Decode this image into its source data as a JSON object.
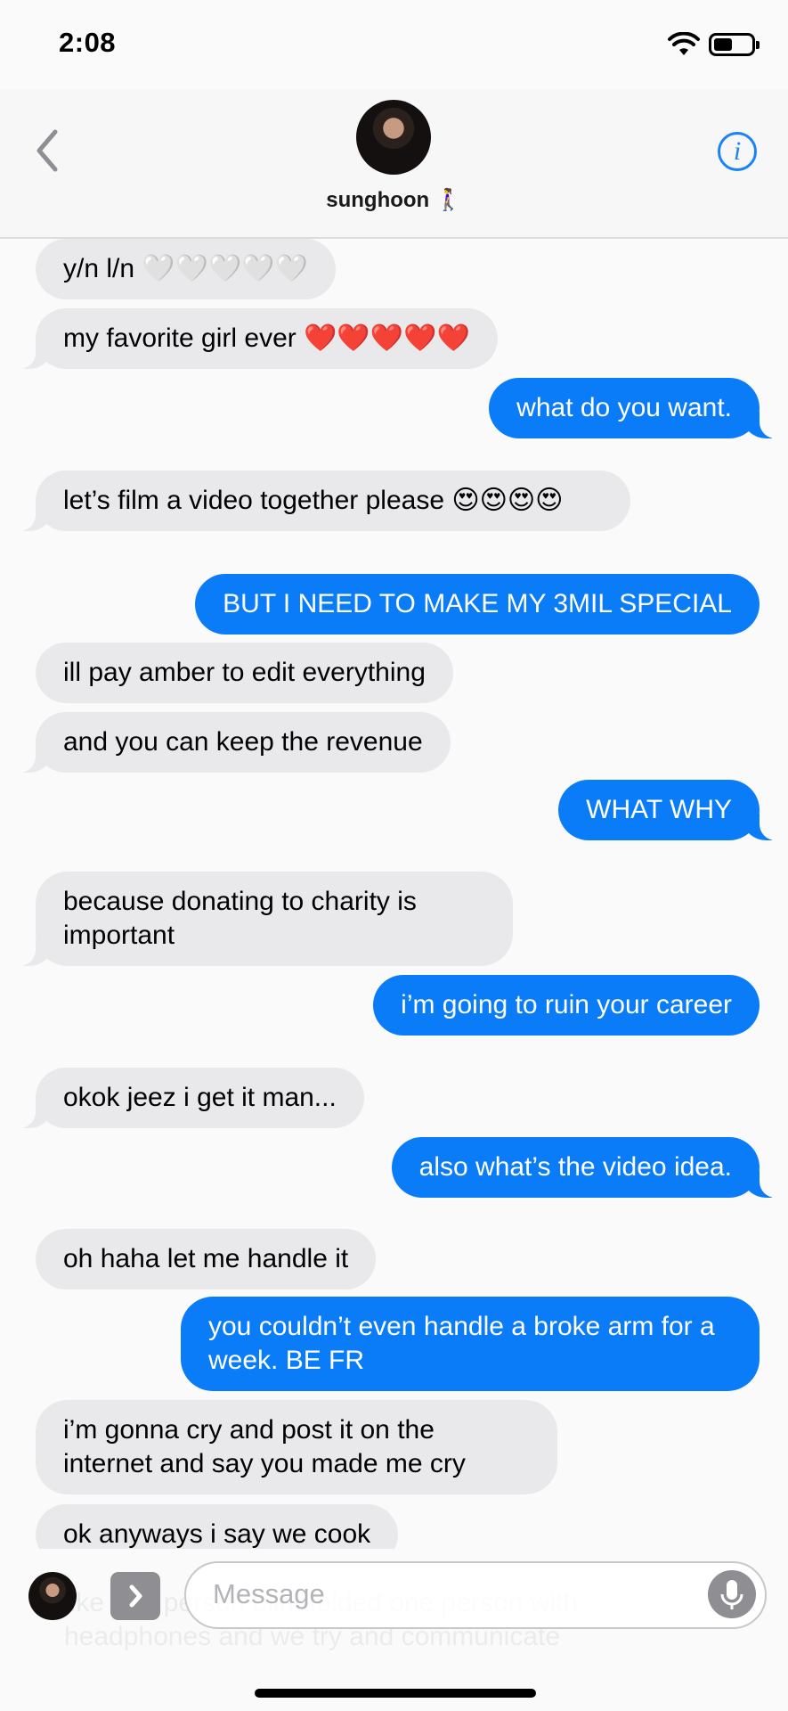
{
  "status_bar": {
    "time": "2:08"
  },
  "header": {
    "contact_name": "sunghoon 🚶‍♀️"
  },
  "messages": [
    {
      "dir": "received",
      "text": "y/n l/n 🤍🤍🤍🤍🤍"
    },
    {
      "dir": "received",
      "text": "my favorite girl ever ❤️❤️❤️❤️❤️"
    },
    {
      "dir": "sent",
      "text": "what do you want."
    },
    {
      "dir": "received",
      "text": "let’s film a video together please 😍😍😍😍"
    },
    {
      "dir": "sent",
      "text": "BUT I NEED TO MAKE MY 3MIL SPECIAL"
    },
    {
      "dir": "received",
      "text": "ill pay amber to edit everything"
    },
    {
      "dir": "received",
      "text": "and you can keep the revenue"
    },
    {
      "dir": "sent",
      "text": "WHAT WHY"
    },
    {
      "dir": "received",
      "text": "because donating to charity is important"
    },
    {
      "dir": "sent",
      "text": "i’m going to ruin your career"
    },
    {
      "dir": "received",
      "text": "okok jeez i get it man..."
    },
    {
      "dir": "sent",
      "text": "also what’s the video idea."
    },
    {
      "dir": "received",
      "text": "oh haha let me handle it"
    },
    {
      "dir": "sent",
      "text": "you couldn’t even handle a broke arm for a week. BE FR"
    },
    {
      "dir": "received",
      "text": "i’m gonna cry and post it on the internet and say you made me cry"
    },
    {
      "dir": "received",
      "text": "ok anyways i say we cook"
    },
    {
      "dir": "received",
      "text": "like one person blindfolded one person with headphones and we try and communicate"
    }
  ],
  "input": {
    "placeholder": "Message"
  },
  "icons": {
    "back": "chevron-left-icon",
    "info": "info-icon",
    "apps": "chevron-right-icon",
    "mic": "microphone-icon"
  },
  "colors": {
    "sent_bubble": "#0b7cf7",
    "received_bubble": "#e9e9eb",
    "accent": "#1a82fb"
  }
}
